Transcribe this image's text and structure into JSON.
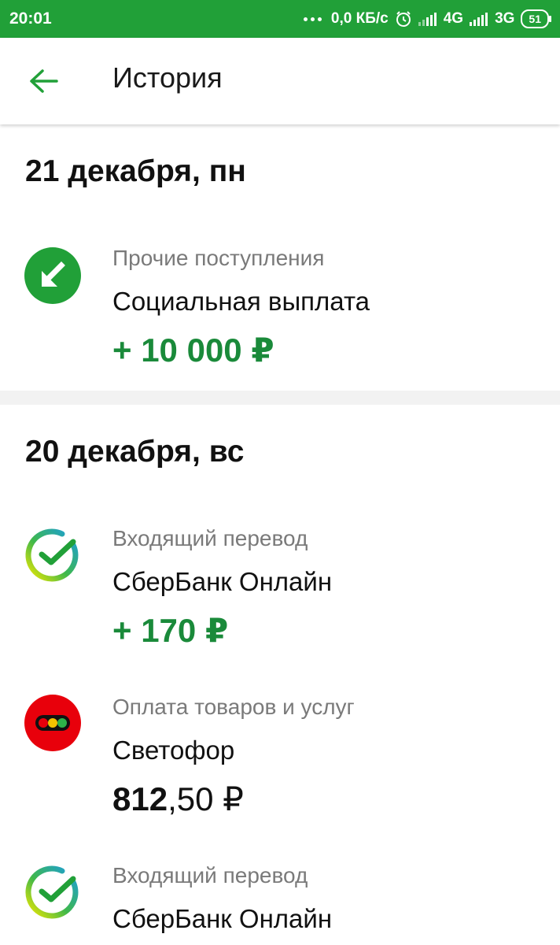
{
  "status_bar": {
    "time": "20:01",
    "network_speed": "0,0 КБ/с",
    "network1": "4G",
    "network2": "3G",
    "battery": "51"
  },
  "header": {
    "title": "История"
  },
  "days": [
    {
      "date": "21 декабря, пн",
      "transactions": [
        {
          "icon": "incoming-arrow-icon",
          "category": "Прочие поступления",
          "name": "Социальная выплата",
          "amount": "+ 10 000 ₽"
        }
      ]
    },
    {
      "date": "20 декабря, вс",
      "transactions": [
        {
          "icon": "sberbank-logo-icon",
          "category": "Входящий перевод",
          "name": "СберБанк Онлайн",
          "amount": "+ 170 ₽"
        },
        {
          "icon": "svetofor-logo-icon",
          "category": "Оплата товаров и услуг",
          "name": "Светофор",
          "amount_int": "812",
          "amount_frac": ",50 ₽"
        },
        {
          "icon": "sberbank-logo-icon",
          "category": "Входящий перевод",
          "name": "СберБанк Онлайн"
        }
      ]
    }
  ],
  "colors": {
    "brand_green": "#21a038",
    "income_green": "#1a8a3a",
    "svetofor_red": "#e8000b"
  }
}
